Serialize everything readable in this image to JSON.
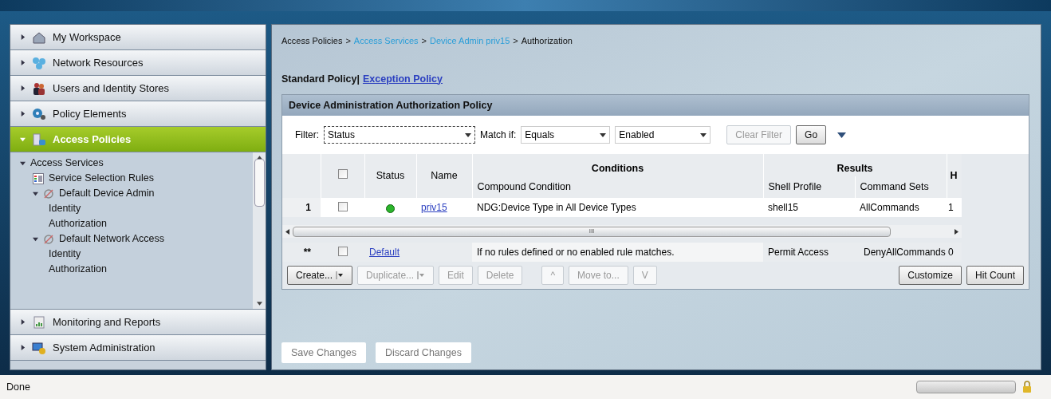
{
  "nav": {
    "sections": [
      {
        "label": "My Workspace",
        "expanded": false,
        "selected": false
      },
      {
        "label": "Network Resources",
        "expanded": false,
        "selected": false
      },
      {
        "label": "Users and Identity Stores",
        "expanded": false,
        "selected": false
      },
      {
        "label": "Policy Elements",
        "expanded": false,
        "selected": false
      },
      {
        "label": "Access Policies",
        "expanded": true,
        "selected": true,
        "tree": [
          {
            "label": "Access Services",
            "kind": "group",
            "expanded": true,
            "children": [
              {
                "label": "Service Selection Rules",
                "kind": "rules"
              },
              {
                "label": "Default Device Admin",
                "kind": "service",
                "expanded": true,
                "children": [
                  {
                    "label": "Identity",
                    "kind": "page"
                  },
                  {
                    "label": "Authorization",
                    "kind": "page"
                  }
                ]
              },
              {
                "label": "Default Network Access",
                "kind": "service",
                "expanded": true,
                "children": [
                  {
                    "label": "Identity",
                    "kind": "page"
                  },
                  {
                    "label": "Authorization",
                    "kind": "page"
                  }
                ]
              }
            ]
          }
        ]
      },
      {
        "label": "Monitoring and Reports",
        "expanded": false,
        "selected": false
      },
      {
        "label": "System Administration",
        "expanded": false,
        "selected": false
      }
    ]
  },
  "breadcrumb_separator": ">",
  "breadcrumb": [
    {
      "text": "Access Policies",
      "link": false
    },
    {
      "text": "Access Services",
      "link": true
    },
    {
      "text": "Device Admin priv15",
      "link": true
    },
    {
      "text": "Authorization",
      "link": false
    }
  ],
  "policy_tabs": [
    {
      "label": "Standard Policy|",
      "selected": true
    },
    {
      "label": "Exception Policy",
      "selected": false
    }
  ],
  "panel": {
    "title": "Device Administration Authorization Policy",
    "filter": {
      "label": "Filter:",
      "field": "Status",
      "match_label": "Match if:",
      "operator": "Equals",
      "value": "Enabled",
      "buttons": [
        {
          "label": "Clear Filter",
          "disabled": true
        },
        {
          "label": "Go",
          "disabled": false
        }
      ]
    },
    "table": {
      "groups": [
        "Conditions",
        "Results",
        "H"
      ],
      "columns": [
        "Status",
        "Name",
        "Compound Condition",
        "Shell Profile",
        "Command Sets"
      ],
      "header_checked": false,
      "rows": [
        {
          "number": "1",
          "checked": false,
          "enabled": true,
          "name": "priv15",
          "condition": "NDG:Device Type in All Device Types",
          "shell_profile": "shell15",
          "command_sets": "AllCommands",
          "hits": "1"
        }
      ],
      "scrollbar_label": "III",
      "default_row": {
        "number": "**",
        "checked": false,
        "name": "Default",
        "condition": "If no rules defined or no enabled rule matches.",
        "shell_profile": "Permit Access",
        "command_sets": "DenyAllCommands",
        "hits": "0"
      }
    },
    "actions": [
      {
        "label": "Create...",
        "kind": "menu",
        "disabled": false
      },
      {
        "label": "Duplicate...",
        "kind": "menu",
        "disabled": true
      },
      {
        "label": "Edit",
        "kind": "plain",
        "disabled": true
      },
      {
        "label": "Delete",
        "kind": "plain",
        "disabled": true
      },
      {
        "label": "^",
        "kind": "plain",
        "disabled": true
      },
      {
        "label": "Move to...",
        "kind": "plain",
        "disabled": true
      },
      {
        "label": "V",
        "kind": "plain",
        "disabled": true
      }
    ],
    "right_actions": [
      {
        "label": "Customize",
        "disabled": false
      },
      {
        "label": "Hit Count",
        "disabled": false
      }
    ]
  },
  "footer_buttons": [
    {
      "label": "Save Changes",
      "disabled": true
    },
    {
      "label": "Discard Changes",
      "disabled": true
    }
  ],
  "status_bar": {
    "text": "Done",
    "progress": {
      "level": 0
    }
  }
}
